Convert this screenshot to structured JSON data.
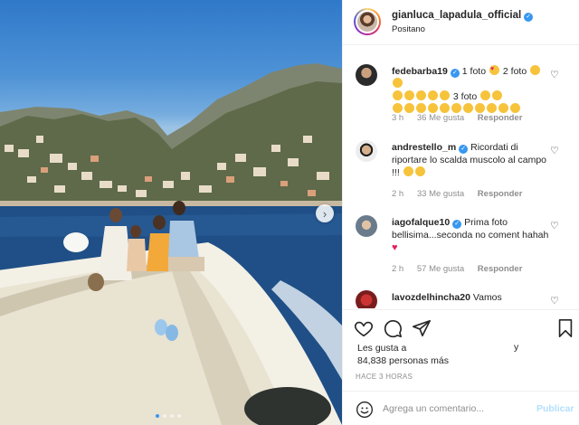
{
  "post": {
    "username": "gianluca_lapadula_official",
    "location": "Positano",
    "more_icon": "more-horizontal-icon",
    "carousel": {
      "total_slides": 4,
      "active_slide": 1
    }
  },
  "comments": [
    {
      "username": "fedebarba19",
      "verified": true,
      "text_parts": [
        "1 foto",
        "2 foto",
        "3 foto"
      ],
      "time": "3 h",
      "likes": "36 Me gusta",
      "reply": "Responder"
    },
    {
      "username": "andrestello_m",
      "verified": true,
      "text": "Ricordati di riportare lo scalda muscolo al campo !!!",
      "time": "2 h",
      "likes": "33 Me gusta",
      "reply": "Responder"
    },
    {
      "username": "iagofalque10",
      "verified": true,
      "text": "Prima foto bellisima...seconda no coment hahah",
      "time": "2 h",
      "likes": "57 Me gusta",
      "reply": "Responder"
    },
    {
      "username": "lavozdelhincha20",
      "text": "Vamos"
    }
  ],
  "actions": {
    "like_icon": "heart-icon",
    "comment_icon": "comment-icon",
    "share_icon": "share-icon",
    "save_icon": "bookmark-icon"
  },
  "likes": {
    "prefix": "Les gusta a",
    "count": "84,838 personas más",
    "suffix": "y"
  },
  "timestamp": "HACE 3 HORAS",
  "comment_box": {
    "placeholder": "Agrega un comentario...",
    "publish": "Publicar"
  },
  "colors": {
    "verified": "#3897f0",
    "publish_disabled": "#b2dffc",
    "heart_red": "#e0245e",
    "sea": "#1f4f86"
  }
}
